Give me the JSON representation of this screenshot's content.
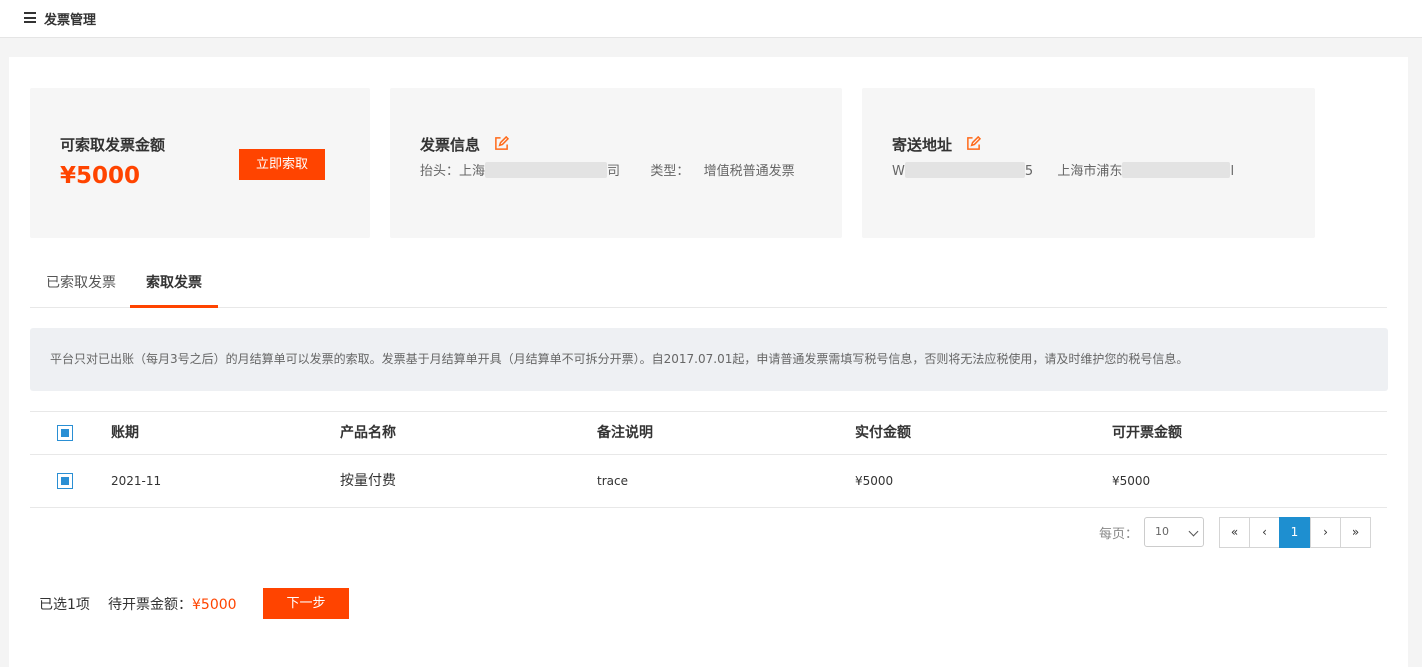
{
  "header": {
    "title": "发票管理"
  },
  "card_claim": {
    "label": "可索取发票金额",
    "amount": "¥5000",
    "button": "立即索取"
  },
  "card_invoice": {
    "label": "发票信息",
    "title_prefix": "抬头：上海",
    "title_suffix": "司",
    "type_label": "类型：",
    "type_value": "增值税普通发票"
  },
  "card_address": {
    "label": "寄送地址",
    "name_prefix": "W",
    "phone_suffix": "5",
    "address_prefix": "上海市浦东",
    "address_suffix": "l"
  },
  "tabs": [
    {
      "label": "已索取发票",
      "active": false
    },
    {
      "label": "索取发票",
      "active": true
    }
  ],
  "notice": "平台只对已出账（每月3号之后）的月结算单可以发票的索取。发票基于月结算单开具（月结算单不可拆分开票）。自2017.07.01起，申请普通发票需填写税号信息，否则将无法应税使用，请及时维护您的税号信息。",
  "table": {
    "columns": [
      "账期",
      "产品名称",
      "备注说明",
      "实付金额",
      "可开票金额"
    ],
    "rows": [
      {
        "period": "2021-11",
        "product": "按量付费",
        "remark": "trace",
        "paid": "¥5000",
        "invoiceable": "¥5000"
      }
    ]
  },
  "pagination": {
    "per_page_label": "每页：",
    "per_page_value": "10",
    "first": "«",
    "prev": "‹",
    "current": "1",
    "next": "›",
    "last": "»"
  },
  "footer": {
    "selected": "已选1项",
    "pending_label": "待开票金额：",
    "pending_amount": "¥5000",
    "next_button": "下一步"
  },
  "colors": {
    "accent": "#ff4400",
    "link_blue": "#1e8fd0"
  }
}
